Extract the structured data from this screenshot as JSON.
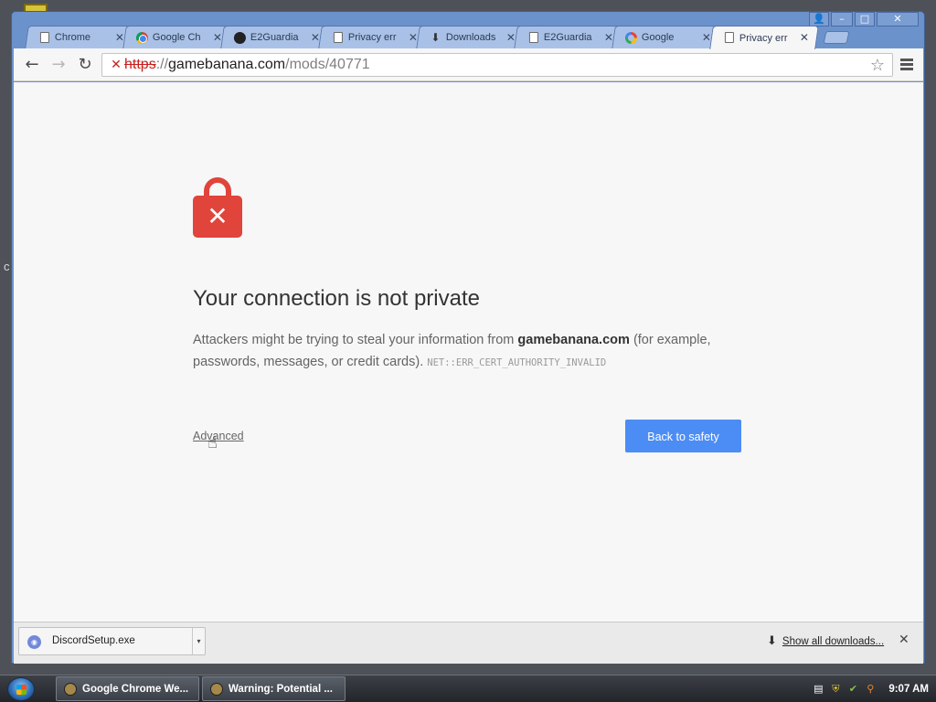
{
  "window": {
    "controls": {
      "profile": "👤",
      "minimize": "–",
      "maximize": "□",
      "close": "✕"
    }
  },
  "tabs": [
    {
      "title": "Chrome",
      "icon": "document-icon"
    },
    {
      "title": "Google Ch",
      "icon": "chrome-logo-icon"
    },
    {
      "title": "E2Guardia",
      "icon": "github-icon"
    },
    {
      "title": "Privacy err",
      "icon": "document-icon"
    },
    {
      "title": "Downloads",
      "icon": "download-icon"
    },
    {
      "title": "E2Guardia",
      "icon": "document-icon"
    },
    {
      "title": "Google",
      "icon": "google-icon"
    },
    {
      "title": "Privacy err",
      "icon": "document-icon",
      "active": true
    }
  ],
  "toolbar": {
    "back": "←",
    "forward": "→",
    "reload": "↻",
    "url": {
      "scheme": "https",
      "separator": "://",
      "host": "gamebanana.com",
      "path": "/mods/40771"
    },
    "star": "☆"
  },
  "interstitial": {
    "heading": "Your connection is not private",
    "message_prefix": "Attackers might be trying to steal your information from",
    "host": "gamebanana.com",
    "message_suffix": "(for example, passwords, messages, or credit cards).",
    "error_code": "NET::ERR_CERT_AUTHORITY_INVALID",
    "advanced_label": "Advanced",
    "back_button_label": "Back to safety",
    "accent_color": "#4c8df5",
    "lock_color": "#e0443b"
  },
  "download_shelf": {
    "item": {
      "filename": "DiscordSetup.exe",
      "menu": "▾"
    },
    "show_all_label": "Show all downloads...",
    "close": "✕"
  },
  "taskbar": {
    "buttons": [
      {
        "label": "Google Chrome We..."
      },
      {
        "label": "Warning: Potential ..."
      }
    ],
    "clock": "9:07 AM"
  },
  "desktop": {
    "stray_text": "c"
  }
}
